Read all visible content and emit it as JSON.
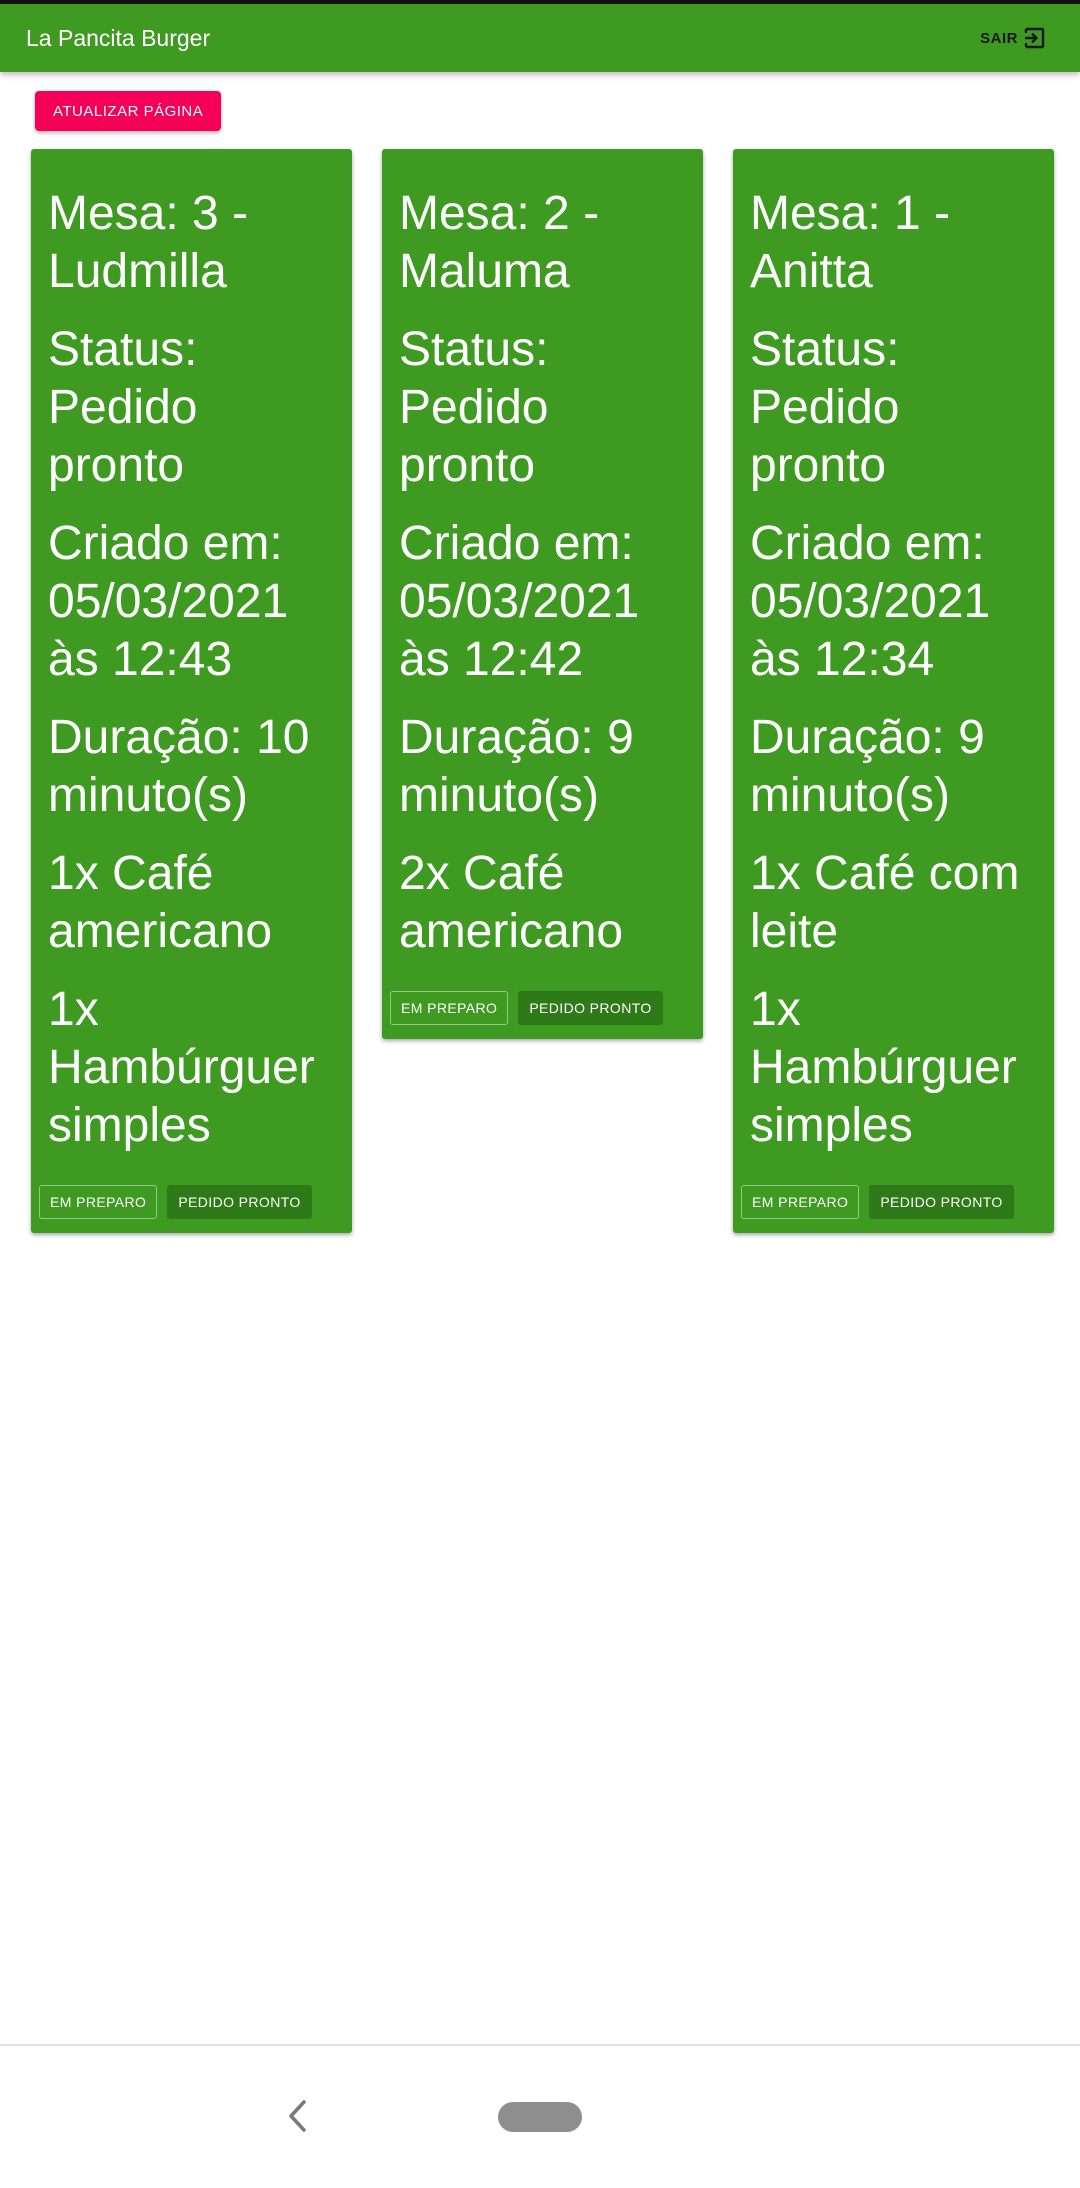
{
  "app": {
    "title": "La Pancita Burger",
    "logout_label": "SAIR",
    "logout_icon": "exit-icon"
  },
  "toolbar": {
    "refresh_label": "ATUALIZAR PÁGINA"
  },
  "orders": [
    {
      "table": "Mesa: 3 - Ludmilla",
      "status": "Status: Pedido pronto",
      "created": "Criado em: 05/03/2021 às 12:43",
      "duration": "Duração: 10 minuto(s)",
      "items": [
        "1x Café americano",
        "1x Hambúrguer simples"
      ],
      "em_preparo_label": "EM PREPARO",
      "pedido_pronto_label": "PEDIDO PRONTO"
    },
    {
      "table": "Mesa: 2 - Maluma",
      "status": "Status: Pedido pronto",
      "created": "Criado em: 05/03/2021 às 12:42",
      "duration": "Duração: 9 minuto(s)",
      "items": [
        "2x Café americano"
      ],
      "em_preparo_label": "EM PREPARO",
      "pedido_pronto_label": "PEDIDO PRONTO"
    },
    {
      "table": "Mesa: 1 - Anitta",
      "status": "Status: Pedido pronto",
      "created": "Criado em: 05/03/2021 às 12:34",
      "duration": "Duração: 9 minuto(s)",
      "items": [
        "1x Café com leite",
        "1x Hambúrguer simples"
      ],
      "em_preparo_label": "EM PREPARO",
      "pedido_pronto_label": "PEDIDO PRONTO"
    }
  ],
  "colors": {
    "primary": "#3f9a22",
    "accent": "#f50057",
    "pedido_pronto_button": "#2f7a18"
  },
  "navbar": {
    "back_icon": "back-chevron-icon",
    "home_icon": "home-pill-icon"
  }
}
